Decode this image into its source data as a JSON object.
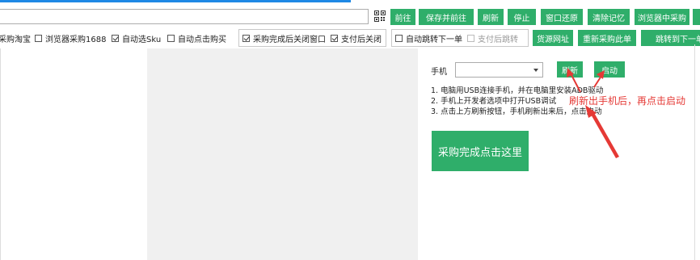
{
  "toolbar": {
    "go": "前往",
    "save_go": "保存并前往",
    "refresh": "刷新",
    "stop": "停止",
    "restore_window": "窗口还原",
    "clear_memory": "清除记忆",
    "browser_purchase": "浏览器中采购"
  },
  "options": {
    "taobao": "采购淘宝",
    "browser_1688": "浏览器采购1688",
    "auto_sku": "自动选Sku",
    "auto_buy": "自动点击购买",
    "close_after": "采购完成后关闭窗口",
    "close_after_pay": "支付后关闭",
    "auto_next": "自动跳转下一单",
    "jump_after_pay": "支付后跳转"
  },
  "actions": {
    "source_url": "货源网址",
    "repurchase": "重新采购此单",
    "jump_next": "跳转到下一单"
  },
  "phone": {
    "label": "手机",
    "refresh": "刷新",
    "start": "启动",
    "instructions": [
      "1. 电脑用USB连接手机，并在电脑里安装ADB驱动",
      "2. 手机上开发者选项中打开USB调试",
      "3. 点击上方刷新按钮，手机刷新出来后，点击启动"
    ],
    "annotation": "刷新出手机后，再点击启动",
    "complete": "采购完成点击这里"
  },
  "colors": {
    "accent_green": "#2fae6a",
    "annotation_red": "#e53935",
    "top_blue": "#1e88e5"
  }
}
